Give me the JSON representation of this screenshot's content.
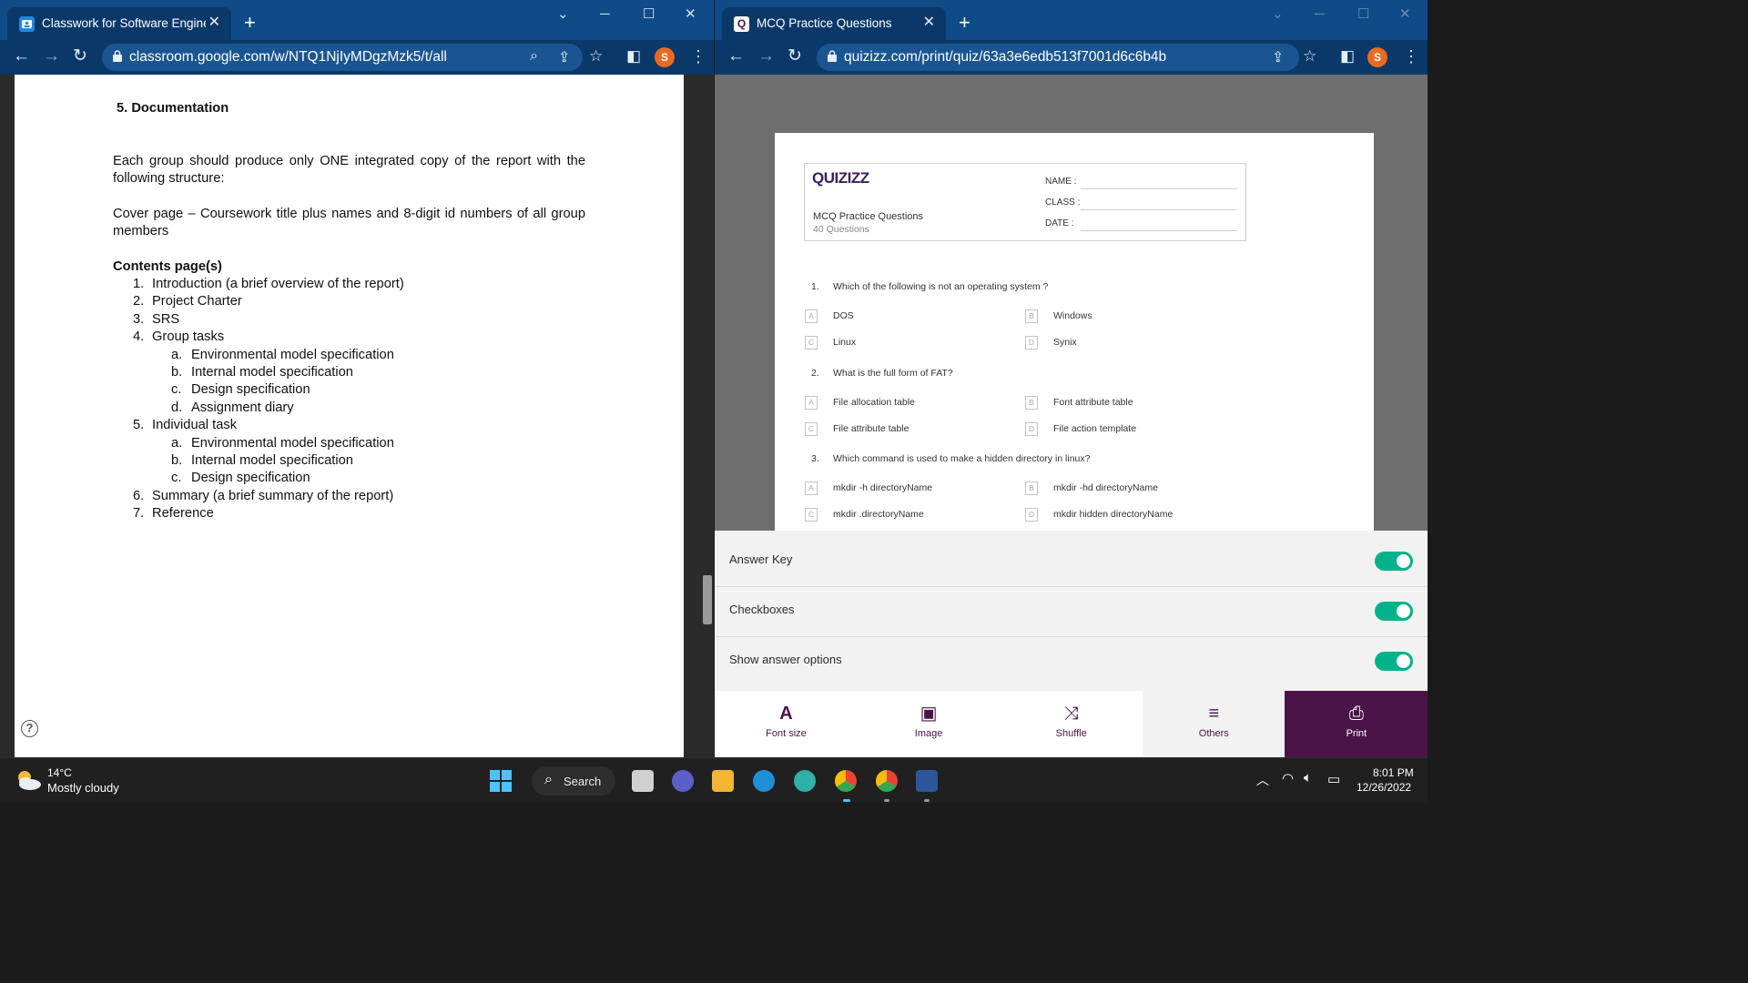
{
  "left_window": {
    "tab_title": "Classwork for Software Engineeri",
    "url": "classroom.google.com/w/NTQ1NjIyMDgzMzk5/t/all",
    "profile_initial": "S",
    "document": {
      "section_heading": "5.  Documentation",
      "intro": "Each group should produce only ONE integrated copy of the report with the following structure:",
      "cover_page": "Cover page – Coursework title plus names and 8-digit id numbers of all group members",
      "contents_heading": "Contents page(s)",
      "list": [
        {
          "n": "1.",
          "text": "Introduction (a brief overview of the report)"
        },
        {
          "n": "2.",
          "text": "Project Charter"
        },
        {
          "n": "3.",
          "text": "SRS"
        },
        {
          "n": "4.",
          "text": "Group tasks"
        },
        {
          "n": "a.",
          "text": "Environmental model specification"
        },
        {
          "n": "b.",
          "text": "Internal model specification"
        },
        {
          "n": "c.",
          "text": "Design specification"
        },
        {
          "n": "d.",
          "text": "Assignment diary"
        },
        {
          "n": "5.",
          "text": "Individual task"
        },
        {
          "n": "a.",
          "text": "Environmental model specification"
        },
        {
          "n": "b.",
          "text": "Internal model specification"
        },
        {
          "n": "c.",
          "text": "Design specification"
        },
        {
          "n": "6.",
          "text": "Summary (a brief summary of the report)"
        },
        {
          "n": "7.",
          "text": "Reference"
        }
      ]
    }
  },
  "right_window": {
    "tab_title": "MCQ Practice Questions",
    "url": "quizizz.com/print/quiz/63a3e6edb513f7001d6c6b4b",
    "profile_initial": "S",
    "quiz": {
      "logo": "QUIZIZZ",
      "title": "MCQ Practice Questions",
      "count": "40 Questions",
      "fields": [
        "NAME :",
        "CLASS :",
        "DATE  :"
      ],
      "questions": [
        {
          "num": "1.",
          "text": "Which of the following is not an operating system ?",
          "options": [
            {
              "letter": "A",
              "text": "DOS"
            },
            {
              "letter": "B",
              "text": "Windows"
            },
            {
              "letter": "C",
              "text": "Linux"
            },
            {
              "letter": "D",
              "text": "Synix"
            }
          ]
        },
        {
          "num": "2.",
          "text": "What is the full form of FAT?",
          "options": [
            {
              "letter": "A",
              "text": "File allocation table"
            },
            {
              "letter": "B",
              "text": "Font attribute table"
            },
            {
              "letter": "C",
              "text": "File attribute table"
            },
            {
              "letter": "D",
              "text": "File action template"
            }
          ]
        },
        {
          "num": "3.",
          "text": "Which command is used to make a hidden directory in linux?",
          "options": [
            {
              "letter": "A",
              "text": "mkdir -h directoryName"
            },
            {
              "letter": "B",
              "text": "mkdir -hd directoryName"
            },
            {
              "letter": "C",
              "text": "mkdir .directoryName"
            },
            {
              "letter": "D",
              "text": "mkdir hidden directoryName"
            }
          ]
        }
      ]
    },
    "settings": [
      {
        "label": "Answer Key",
        "on": true
      },
      {
        "label": "Checkboxes",
        "on": true
      },
      {
        "label": "Show answer options",
        "on": true
      }
    ],
    "bottom_bar": [
      {
        "label": "Font size",
        "icon": "font-size-icon",
        "glyph": "A"
      },
      {
        "label": "Image",
        "icon": "image-icon",
        "glyph": "▣"
      },
      {
        "label": "Shuffle",
        "icon": "shuffle-icon",
        "glyph": "⤨"
      },
      {
        "label": "Others",
        "icon": "sliders-icon",
        "glyph": "≡"
      },
      {
        "label": "Print",
        "icon": "printer-icon",
        "glyph": "⎙"
      }
    ]
  },
  "taskbar": {
    "weather_temp": "14°C",
    "weather_desc": "Mostly cloudy",
    "search_label": "Search",
    "time": "8:01 PM",
    "date": "12/26/2022"
  },
  "colors": {
    "chrome_tabstrip": "#0f4b87",
    "chrome_toolbar": "#0a3969",
    "quizizz_purple": "#4a1448",
    "toggle_on": "#00b289"
  }
}
